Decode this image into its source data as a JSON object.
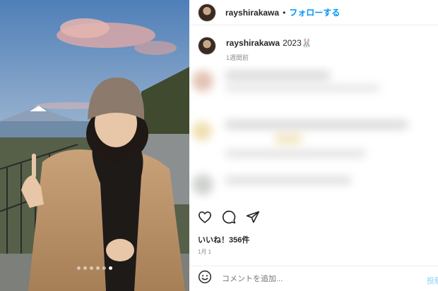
{
  "header": {
    "username": "rayshirakawa",
    "separator": "•",
    "follow_label": "フォローする"
  },
  "caption": {
    "username": "rayshirakawa",
    "text": "2023🐰",
    "time": "1週間前"
  },
  "photo": {
    "dot_count": 6,
    "active_dot": 5
  },
  "actions": {
    "like_icon": "heart-icon",
    "comment_icon": "comment-icon",
    "share_icon": "paper-plane-icon"
  },
  "likes": "いいね！356件",
  "date": "1月 1",
  "comment_bar": {
    "emoji_icon": "smiley-icon",
    "placeholder": "コメントを追加...",
    "post_label": "投稿"
  }
}
